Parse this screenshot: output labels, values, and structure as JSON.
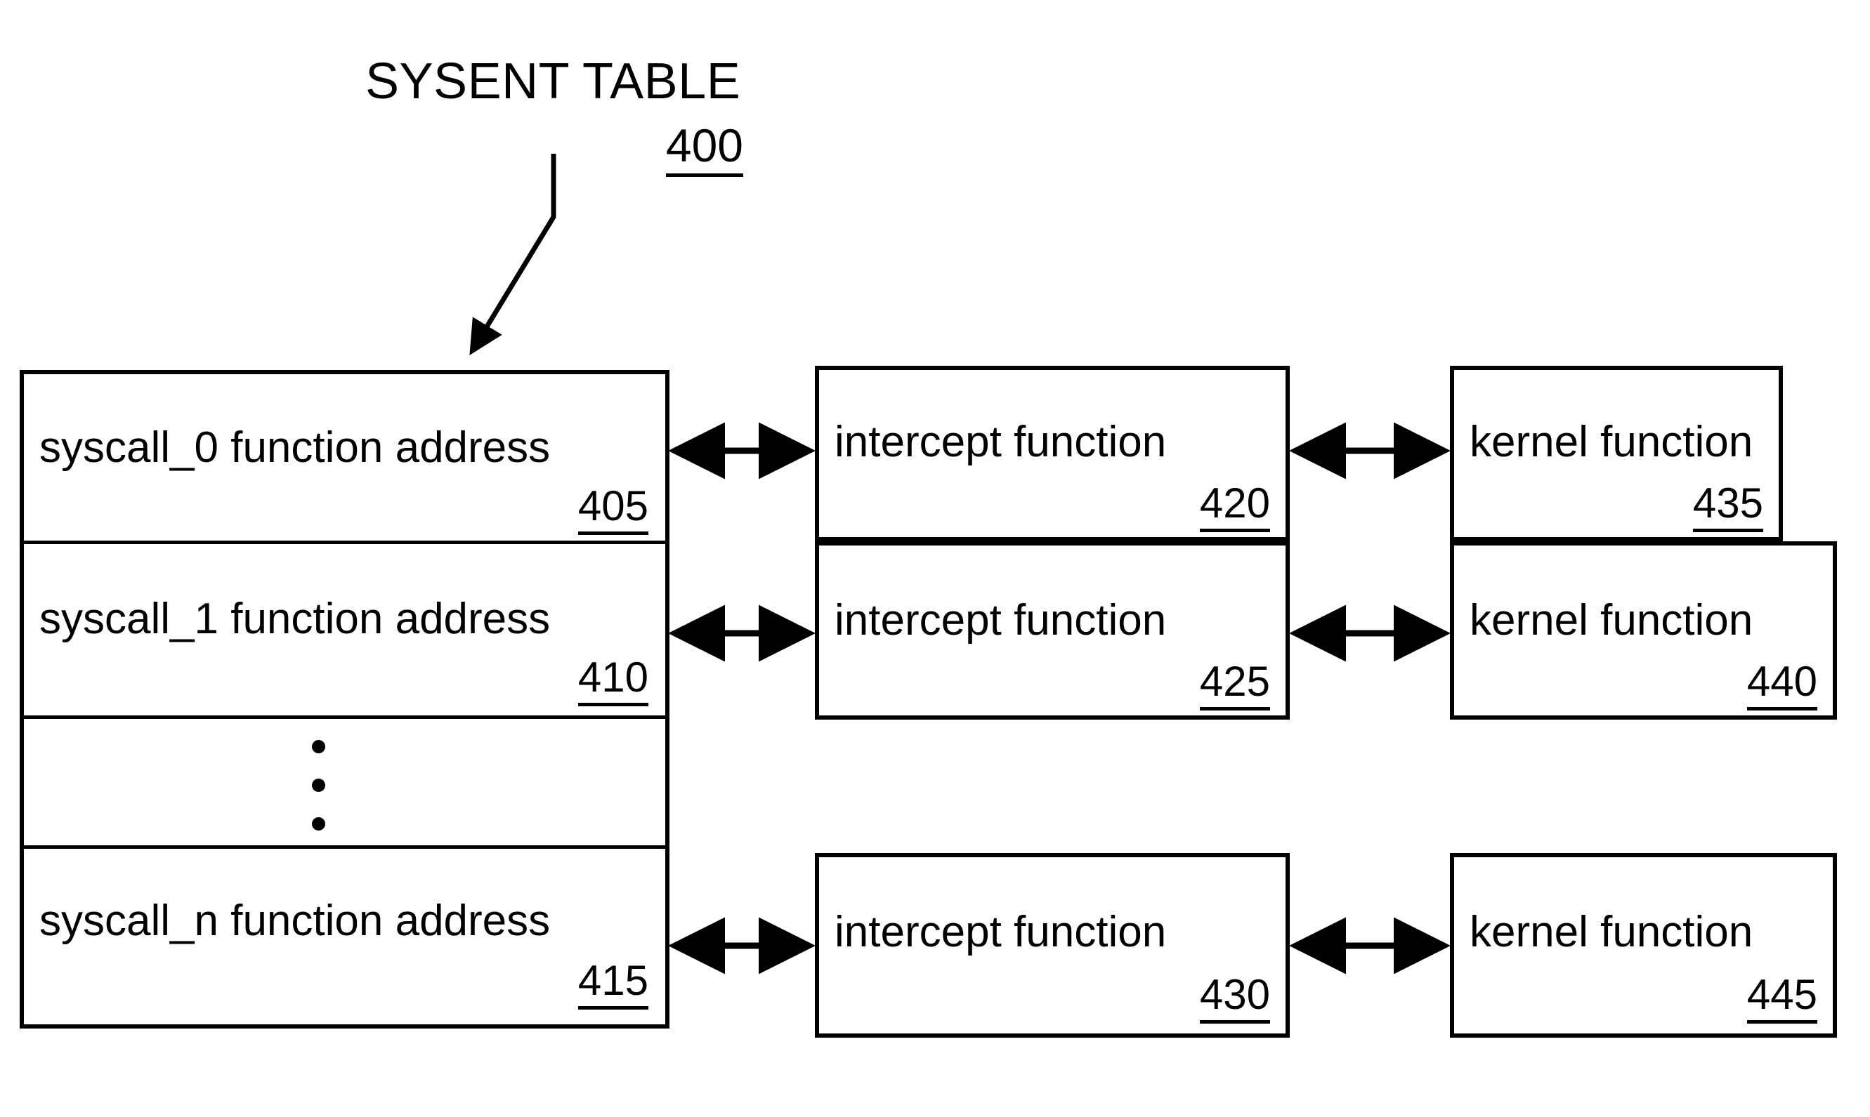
{
  "figure": {
    "title": "SYSENT TABLE",
    "title_ref": "400"
  },
  "sysent_table": {
    "name": "SYSENT TABLE",
    "ref": "400",
    "rows": [
      {
        "label": "syscall_0 function address",
        "ref": "405"
      },
      {
        "label": "syscall_1 function address",
        "ref": "410"
      },
      {
        "label": "",
        "ref": "",
        "ellipsis": true
      },
      {
        "label": "syscall_n function address",
        "ref": "415"
      }
    ]
  },
  "intercept_boxes": [
    {
      "label": "intercept function",
      "ref": "420"
    },
    {
      "label": "intercept function",
      "ref": "425"
    },
    {
      "label": "intercept function",
      "ref": "430"
    }
  ],
  "kernel_boxes": [
    {
      "label": "kernel function",
      "ref": "435"
    },
    {
      "label": "kernel function",
      "ref": "440"
    },
    {
      "label": "kernel function",
      "ref": "445"
    }
  ],
  "connectors": [
    {
      "from": "405",
      "to": "420",
      "style": "double-arrow"
    },
    {
      "from": "420",
      "to": "435",
      "style": "double-arrow"
    },
    {
      "from": "410",
      "to": "425",
      "style": "double-arrow"
    },
    {
      "from": "425",
      "to": "440",
      "style": "double-arrow"
    },
    {
      "from": "415",
      "to": "430",
      "style": "double-arrow"
    },
    {
      "from": "430",
      "to": "445",
      "style": "double-arrow"
    }
  ],
  "colors": {
    "ink": "#000000",
    "paper": "#ffffff"
  }
}
